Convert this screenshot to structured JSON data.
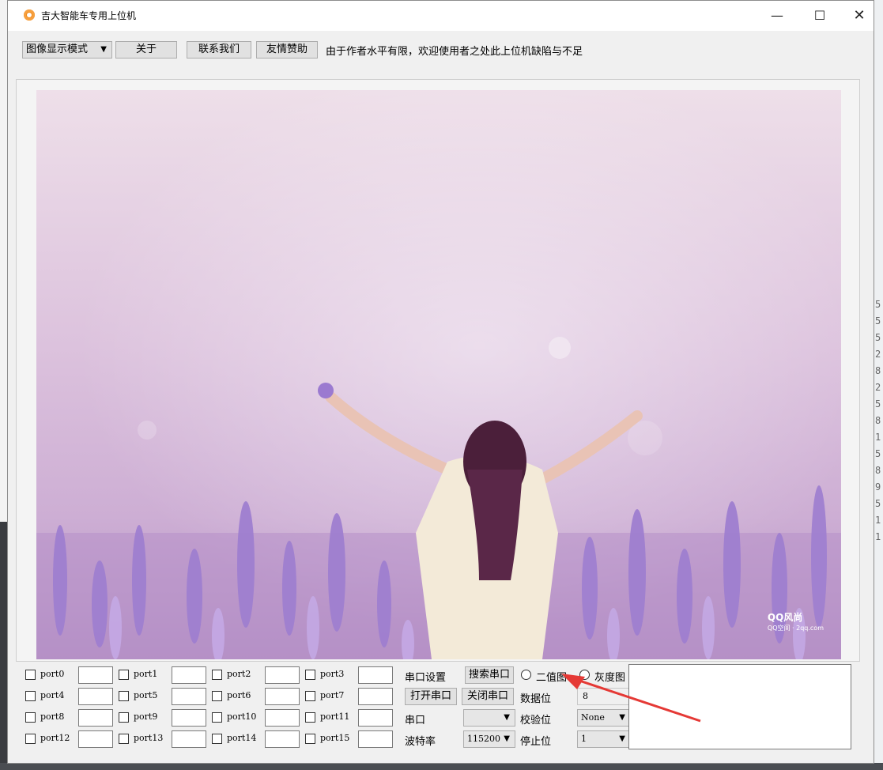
{
  "window": {
    "title": "吉大智能车专用上位机"
  },
  "titlebar_controls": {
    "minimize": "—",
    "maximize": "☐",
    "close": "✕"
  },
  "toolbar": {
    "mode_select": "图像显示模式",
    "about": "关于",
    "contact": "联系我们",
    "donate": "友情赞助",
    "notice": "由于作者水平有限，欢迎使用者之处此上位机缺陷与不足"
  },
  "watermark": {
    "brand": "QQ风尚",
    "sub": "QQ空间 · 2qq.com"
  },
  "ports": [
    [
      "port0",
      "port1",
      "port2",
      "port3"
    ],
    [
      "port4",
      "port5",
      "port6",
      "port7"
    ],
    [
      "port8",
      "port9",
      "port10",
      "port11"
    ],
    [
      "port12",
      "port13",
      "port14",
      "port15"
    ]
  ],
  "serial": {
    "settings_label": "串口设置",
    "search_button": "搜索串口",
    "binary_radio": "二值图",
    "gray_radio": "灰度图",
    "open_button": "打开串口",
    "close_button": "关闭串口",
    "data_bits_label": "数据位",
    "data_bits_value": "8",
    "port_label": "串口",
    "port_value": "",
    "parity_label": "校验位",
    "parity_value": "None",
    "baud_label": "波特率",
    "baud_value": "115200",
    "stop_bits_label": "停止位",
    "stop_bits_value": "1"
  },
  "background": {
    "right_digits": [
      "5",
      "5",
      "5",
      "2",
      "8",
      "2",
      "5",
      "8",
      "1",
      "5",
      "8",
      "9",
      "5",
      "1",
      "1"
    ]
  },
  "colors": {
    "accent_arrow": "#e53935",
    "app_icon": "#f28b1c"
  }
}
